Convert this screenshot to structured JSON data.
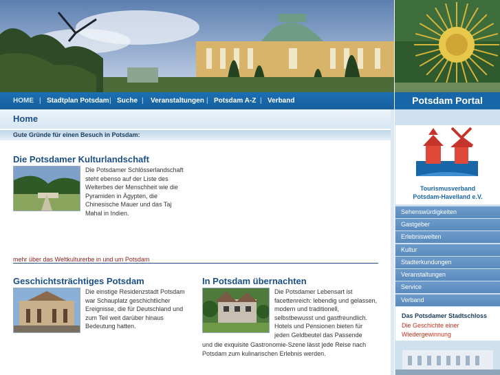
{
  "nav": {
    "items": [
      "HOME",
      "Stadtplan Potsdam",
      "Suche",
      "Veranstaltungen",
      "Potsdam A-Z",
      "Verband"
    ],
    "separator": "|"
  },
  "sidebar": {
    "title": "Potsdam Portal",
    "logo_line1": "Tourismusverband",
    "logo_line2": "Potsdam-Havelland e.V.",
    "menu": [
      "Sehenswürdigkeiten",
      "Gastgeber",
      "Erlebniswelten",
      "Kultur",
      "Stadterkundungen",
      "Veranstaltungen",
      "Service",
      "Verband"
    ],
    "feature_title": "Das Potsdamer Stadtschloss",
    "feature_sub": "Die Geschichte einer Wiedergewinnung"
  },
  "main": {
    "page_title": "Home",
    "intro": "Gute Gründe für einen Besuch in Potsdam:",
    "section1": {
      "heading": "Die Potsdamer Kulturlandschaft",
      "text": "Die Potsdamer Schlösserlandschaft steht ebenso auf der Liste des Welterbes der Menschheit wie die Pyramiden in Ägypten, die Chinesische Mauer und das Taj Mahal in Indien.",
      "more": "mehr über das Weltkulturerbe in und um Potsdam"
    },
    "section2": {
      "heading": "Geschichtsträchtiges Potsdam",
      "text": "Die einstige Residenzstadt Potsdam war Schauplatz geschichtlicher Ereignisse, die für Deutschland und zum Teil weit darüber hinaus Bedeutung hatten."
    },
    "section3": {
      "heading": "In Potsdam übernachten",
      "text1": "Die Potsdamer Lebensart ist facettenreich: lebendig und gelassen, modern und traditionell, selbstbewusst und gastfreundlich. Hotels und Pensionen bieten für jeden Geldbeutel das Passende",
      "text2": "und die exquisite Gastronomie-Szene lässt jede Reise nach Potsdam zum kulinarischen Erlebnis werden."
    }
  },
  "colors": {
    "nav_blue": "#1766a8",
    "heading_blue": "#1a4f86",
    "link_red": "#8a1d1d",
    "side_menu": "#5f90c2"
  }
}
